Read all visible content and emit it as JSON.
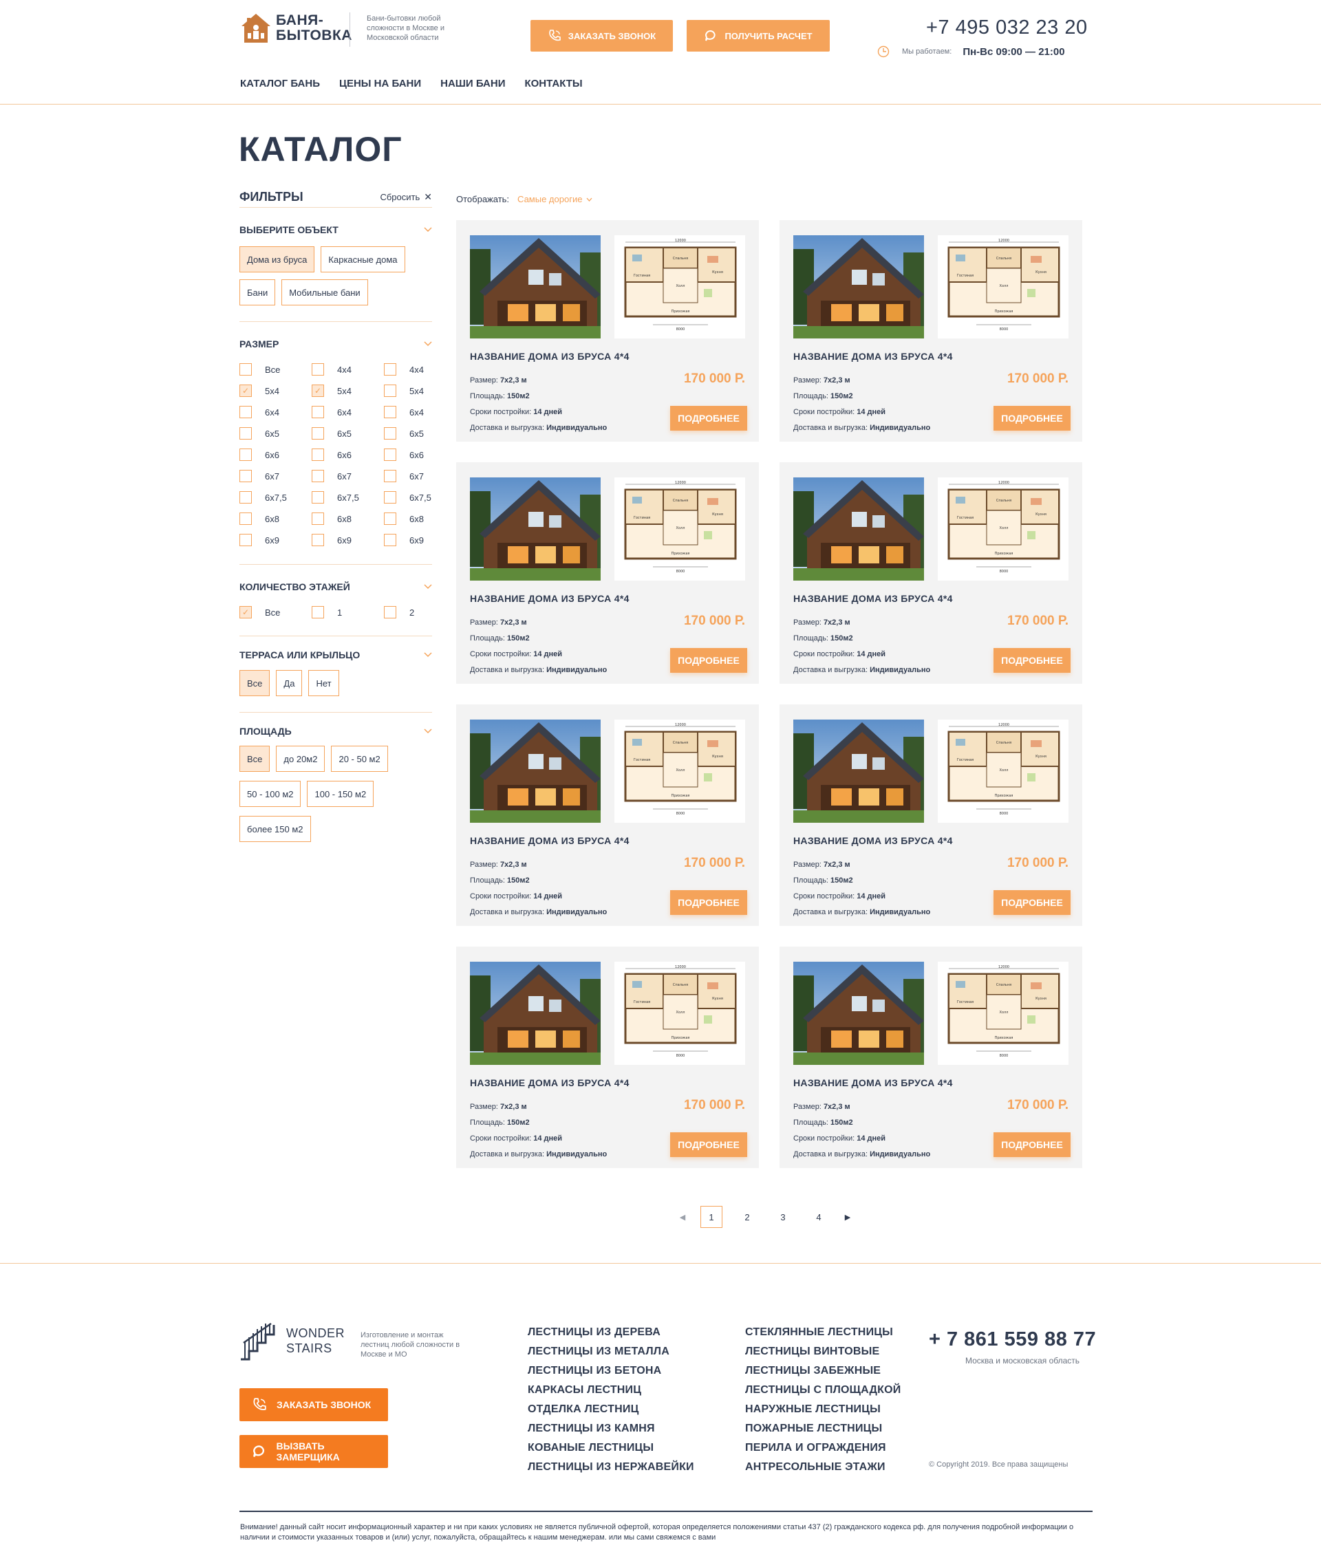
{
  "brand": {
    "name_line1": "БАНЯ-",
    "name_line2": "БЫТОВКА",
    "tagline": "Бани-бытовки любой сложности в Москве и Московской области"
  },
  "header": {
    "call_button": "Заказать звонок",
    "calc_button": "Получить расчет",
    "phone": "+7 495 032 23 20",
    "hours_label": "Мы работаем:",
    "hours_value": "Пн-Вс 09:00 — 21:00"
  },
  "nav": [
    "КАТАЛОГ БАНЬ",
    "ЦЕНЫ НА БАНИ",
    "НАШИ БАНИ",
    "КОНТАКТЫ"
  ],
  "catalog": {
    "title": "КАТАЛОГ",
    "sort_label": "Отображать:",
    "sort_value": "Самые дорогие"
  },
  "filters": {
    "title": "ФИЛЬТРЫ",
    "reset": "Сбросить",
    "object": {
      "title": "ВЫБЕРИТЕ ОБЪЕКТ",
      "options": [
        {
          "label": "Дома из бруса",
          "active": true
        },
        {
          "label": "Каркасные дома",
          "active": false
        },
        {
          "label": "Бани",
          "active": false
        },
        {
          "label": "Мобильные бани",
          "active": false
        }
      ]
    },
    "size": {
      "title": "РАЗМЕР",
      "options": [
        {
          "label": "Все",
          "checked": false
        },
        {
          "label": "4х4",
          "checked": false
        },
        {
          "label": "4х4",
          "checked": false
        },
        {
          "label": "5х4",
          "checked": true
        },
        {
          "label": "5х4",
          "checked": true
        },
        {
          "label": "5х4",
          "checked": false
        },
        {
          "label": "6х4",
          "checked": false
        },
        {
          "label": "6х4",
          "checked": false
        },
        {
          "label": "6х4",
          "checked": false
        },
        {
          "label": "6х5",
          "checked": false
        },
        {
          "label": "6х5",
          "checked": false
        },
        {
          "label": "6х5",
          "checked": false
        },
        {
          "label": "6х6",
          "checked": false
        },
        {
          "label": "6х6",
          "checked": false
        },
        {
          "label": "6х6",
          "checked": false
        },
        {
          "label": "6х7",
          "checked": false
        },
        {
          "label": "6х7",
          "checked": false
        },
        {
          "label": "6х7",
          "checked": false
        },
        {
          "label": "6х7,5",
          "checked": false
        },
        {
          "label": "6х7,5",
          "checked": false
        },
        {
          "label": "6х7,5",
          "checked": false
        },
        {
          "label": "6х8",
          "checked": false
        },
        {
          "label": "6х8",
          "checked": false
        },
        {
          "label": "6х8",
          "checked": false
        },
        {
          "label": "6х9",
          "checked": false
        },
        {
          "label": "6х9",
          "checked": false
        },
        {
          "label": "6х9",
          "checked": false
        }
      ]
    },
    "floors": {
      "title": "КОЛИЧЕСТВО ЭТАЖЕЙ",
      "options": [
        {
          "label": "Все",
          "checked": true
        },
        {
          "label": "1",
          "checked": false
        },
        {
          "label": "2",
          "checked": false
        }
      ]
    },
    "terrace": {
      "title": "ТЕРРАСА ИЛИ КРЫЛЬЦО",
      "options": [
        {
          "label": "Все",
          "active": true
        },
        {
          "label": "Да",
          "active": false
        },
        {
          "label": "Нет",
          "active": false
        }
      ]
    },
    "area": {
      "title": "ПЛОЩАДЬ",
      "options": [
        {
          "label": "Все",
          "active": true
        },
        {
          "label": "до 20м2",
          "active": false
        },
        {
          "label": "20 - 50 м2",
          "active": false
        },
        {
          "label": "50 - 100 м2",
          "active": false
        },
        {
          "label": "100 - 150 м2",
          "active": false
        },
        {
          "label": "более 150 м2",
          "active": false
        }
      ]
    }
  },
  "product": {
    "name": "НАЗВАНИЕ ДОМА ИЗ БРУСА 4*4",
    "price": "170 000 Р.",
    "size_label": "Размер:",
    "size_value": "7х2,3 м",
    "area_label": "Площадь:",
    "area_value": "150м2",
    "term_label": "Сроки постройки:",
    "term_value": "14 дней",
    "delivery_label": "Доставка и выгрузка:",
    "delivery_value": "Индивидуально",
    "button": "ПОДРОБНЕЕ",
    "plan_labels": {
      "top": "12000",
      "bottom": "8000",
      "rooms": [
        "Гостиная",
        "Спальня",
        "Кухня",
        "Холл",
        "Прихожая"
      ]
    }
  },
  "pagination": [
    "1",
    "2",
    "3",
    "4"
  ],
  "footer": {
    "brand_line1": "WONDER",
    "brand_line2": "STAIRS",
    "tagline": "Изготовление и монтаж лестниц любой сложности в Москве и МО",
    "call_button": "ЗАКАЗАТЬ ЗВОНОК",
    "measure_button": "ВЫЗВАТЬ ЗАМЕРЩИКА",
    "links_col1": [
      "ЛЕСТНИЦЫ ИЗ ДЕРЕВА",
      "ЛЕСТНИЦЫ ИЗ МЕТАЛЛА",
      "ЛЕСТНИЦЫ ИЗ БЕТОНА",
      "КАРКАСЫ ЛЕСТНИЦ",
      "ОТДЕЛКА ЛЕСТНИЦ",
      "ЛЕСТНИЦЫ ИЗ КАМНЯ",
      "КОВАНЫЕ ЛЕСТНИЦЫ",
      "ЛЕСТНИЦЫ ИЗ НЕРЖАВЕЙКИ"
    ],
    "links_col2": [
      "СТЕКЛЯННЫЕ ЛЕСТНИЦЫ",
      "ЛЕСТНИЦЫ ВИНТОВЫЕ",
      "ЛЕСТНИЦЫ ЗАБЕЖНЫЕ",
      "ЛЕСТНИЦЫ С ПЛОЩАДКОЙ",
      "НАРУЖНЫЕ ЛЕСТНИЦЫ",
      "ПОЖАРНЫЕ ЛЕСТНИЦЫ",
      "ПЕРИЛА И ОГРАЖДЕНИЯ",
      "АНТРЕСОЛЬНЫЕ ЭТАЖИ"
    ],
    "phone": "+ 7 861 559 88 77",
    "region": "Москва и московская область",
    "copyright": "© Copyright 2019. Все права защищены",
    "disclaimer": "Внимание! данный сайт носит информационный характер и ни при каких условиях не является публичной офертой, которая определяется положениями статьи 437 (2) гражданского кодекса рф. для получения подробной информации о наличии и стоимости указанных товаров и (или) услуг, пожалуйста, обращайтесь к нашим менеджерам. или мы сами свяжемся с вами"
  },
  "colors": {
    "accent": "#f5a35a",
    "accent_dark": "#f47b20",
    "text": "#2f3a4f",
    "card_bg": "#f3f3f3"
  }
}
